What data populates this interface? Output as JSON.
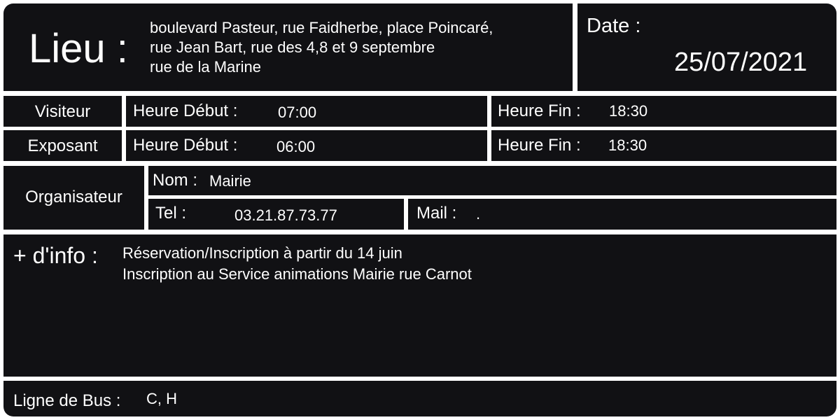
{
  "lieu": {
    "label": "Lieu :",
    "lines": [
      "boulevard Pasteur, rue Faidherbe, place Poincaré,",
      "rue Jean Bart, rue des 4,8 et 9 septembre",
      "rue de la Marine"
    ]
  },
  "date": {
    "label": "Date :",
    "value": "25/07/2021"
  },
  "visiteur": {
    "label": "Visiteur",
    "start_label": "Heure Début :",
    "start_value": "07:00",
    "end_label": "Heure Fin :",
    "end_value": "18:30"
  },
  "exposant": {
    "label": "Exposant",
    "start_label": "Heure Début :",
    "start_value": "06:00",
    "end_label": "Heure Fin :",
    "end_value": "18:30"
  },
  "organisateur": {
    "label": "Organisateur",
    "nom_label": "Nom :",
    "nom_value": "Mairie",
    "tel_label": "Tel :",
    "tel_value": "03.21.87.73.77",
    "mail_label": "Mail :",
    "mail_value": "."
  },
  "info": {
    "label": "+ d'info :",
    "lines": [
      "Réservation/Inscription à partir du 14 juin",
      "Inscription au Service animations Mairie rue Carnot"
    ]
  },
  "bus": {
    "label": "Ligne de Bus :",
    "value": "C, H"
  }
}
